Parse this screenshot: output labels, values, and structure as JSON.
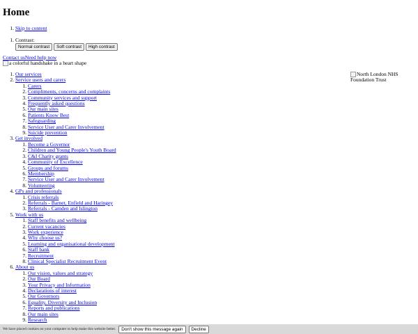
{
  "page": {
    "title": "Home"
  },
  "skip": {
    "label": "Skip to content"
  },
  "contrast": {
    "label": "Contrast:",
    "buttons": [
      "Normal contrast",
      "Soft contrast",
      "High contrast"
    ]
  },
  "util": {
    "contact": "Contact us",
    "help": "Need help now"
  },
  "images": {
    "handshake_alt": "a colorful handshake in a heart shape",
    "nhs_alt": "North London NHS Foundation Trust"
  },
  "nav": {
    "items": [
      {
        "label": "Our services",
        "children": []
      },
      {
        "label": "Service users and carers",
        "children": [
          "Carers",
          "Compliments, concerns and complaints",
          "Community services and support",
          "Frequently asked questions",
          "Our main sites",
          "Patients Know Best",
          "Safeguarding",
          "Service User and Carer Involvement",
          "Suicide prevention"
        ]
      },
      {
        "label": "Get involved",
        "children": [
          "Become a Governor",
          "Children and Young People's Youth Board",
          "C&I Charity grants",
          "Community of Excellence",
          "Groups and forums",
          "Membership",
          "Service User and Carer Involvement",
          "Volunteering"
        ]
      },
      {
        "label": "GPs and professionals",
        "children": [
          "Crisis referrals",
          "Referrals - Barnet, Enfield and Haringey",
          "Referrals - Camden and Islington"
        ]
      },
      {
        "label": "Work with us",
        "children": [
          "Staff benefits and wellbeing",
          "Current vacancies",
          "Work experience",
          "Why choose us?",
          "Learning and organisational development",
          "Staff bank",
          "Recruitment",
          "Clinical Specialist Recruitment Event"
        ]
      },
      {
        "label": "About us",
        "children": [
          "Our vision, values and strategy",
          "Our Board",
          "Your Privacy and Information",
          "Declarations of interest",
          "Our Governors",
          "Equality, Diversity and Inclusion",
          "Reports and publications",
          "Our main sites",
          "Research"
        ]
      }
    ]
  },
  "cookie": {
    "text": "We have placed cookies on your computer to help make this website better.",
    "dont_show": "Don't show this message again",
    "decline": "Decline"
  }
}
